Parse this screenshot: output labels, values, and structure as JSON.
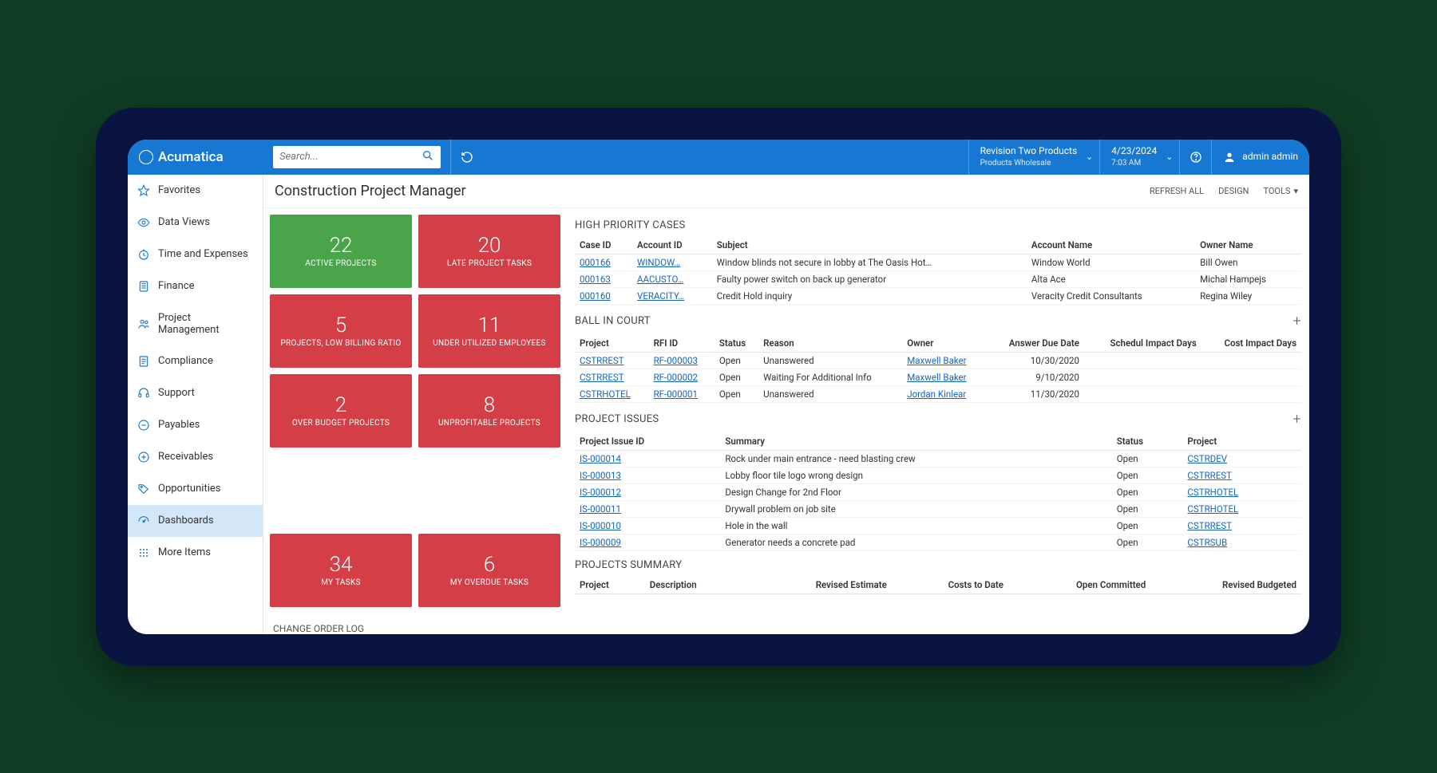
{
  "brand": "Acumatica",
  "search": {
    "placeholder": "Search..."
  },
  "tenant": {
    "name": "Revision Two Products",
    "sub": "Products Wholesale"
  },
  "datetime": {
    "date": "4/23/2024",
    "time": "7:03 AM"
  },
  "user": "admin admin",
  "sidebar": [
    {
      "icon": "star",
      "label": "Favorites"
    },
    {
      "icon": "eye",
      "label": "Data Views"
    },
    {
      "icon": "clock",
      "label": "Time and Expenses"
    },
    {
      "icon": "calc",
      "label": "Finance"
    },
    {
      "icon": "people",
      "label": "Project Management"
    },
    {
      "icon": "doc",
      "label": "Compliance"
    },
    {
      "icon": "headset",
      "label": "Support"
    },
    {
      "icon": "minus",
      "label": "Payables"
    },
    {
      "icon": "plus",
      "label": "Receivables"
    },
    {
      "icon": "tag",
      "label": "Opportunities"
    },
    {
      "icon": "gauge",
      "label": "Dashboards",
      "active": true
    },
    {
      "icon": "grid",
      "label": "More Items"
    }
  ],
  "page": {
    "title": "Construction Project Manager",
    "actions": {
      "refresh": "REFRESH ALL",
      "design": "DESIGN",
      "tools": "TOOLS"
    }
  },
  "tiles": [
    {
      "num": "22",
      "lbl": "ACTIVE PROJECTS",
      "color": "green"
    },
    {
      "num": "20",
      "lbl": "LATE PROJECT TASKS",
      "color": "red"
    },
    {
      "num": "5",
      "lbl": "PROJECTS, LOW BILLING RATIO",
      "color": "red"
    },
    {
      "num": "11",
      "lbl": "UNDER UTILIZED EMPLOYEES",
      "color": "red"
    },
    {
      "num": "2",
      "lbl": "OVER BUDGET PROJECTS",
      "color": "red"
    },
    {
      "num": "8",
      "lbl": "UNPROFITABLE PROJECTS",
      "color": "red"
    },
    {
      "num": "34",
      "lbl": "MY TASKS",
      "color": "red",
      "spaced": true
    },
    {
      "num": "6",
      "lbl": "MY OVERDUE TASKS",
      "color": "red"
    }
  ],
  "change_log_title": "CHANGE ORDER LOG",
  "high_priority": {
    "title": "HIGH PRIORITY CASES",
    "cols": [
      "Case ID",
      "Account ID",
      "Subject",
      "Account Name",
      "Owner Name"
    ],
    "rows": [
      {
        "case": "000166",
        "acct": "WINDOW…",
        "subj": "Window blinds not secure in lobby at The Oasis Hot…",
        "aname": "Window World",
        "owner": "Bill Owen"
      },
      {
        "case": "000163",
        "acct": "AACUSTO…",
        "subj": "Faulty power switch on back up generator",
        "aname": "Alta Ace",
        "owner": "Michal Hampejs"
      },
      {
        "case": "000160",
        "acct": "VERACITY…",
        "subj": "Credit Hold inquiry",
        "aname": "Veracity Credit Consultants",
        "owner": "Regina Wiley"
      }
    ]
  },
  "ball_in_court": {
    "title": "BALL IN COURT",
    "cols": [
      "Project",
      "RFI ID",
      "Status",
      "Reason",
      "Owner",
      "Answer Due Date",
      "Schedul Impact Days",
      "Cost Impact Days"
    ],
    "rows": [
      {
        "proj": "CSTRREST",
        "rfi": "RF-000003",
        "status": "Open",
        "reason": "Unanswered",
        "owner": "Maxwell Baker",
        "due": "10/30/2020"
      },
      {
        "proj": "CSTRREST",
        "rfi": "RF-000002",
        "status": "Open",
        "reason": "Waiting For Additional Info",
        "owner": "Maxwell Baker",
        "due": "9/10/2020"
      },
      {
        "proj": "CSTRHOTEL",
        "rfi": "RF-000001",
        "status": "Open",
        "reason": "Unanswered",
        "owner": "Jordan Kinlear",
        "due": "11/30/2020"
      }
    ]
  },
  "project_issues": {
    "title": "PROJECT ISSUES",
    "cols": [
      "Project Issue ID",
      "Summary",
      "Status",
      "Project"
    ],
    "rows": [
      {
        "id": "IS-000014",
        "sum": "Rock under main entrance - need blasting crew",
        "status": "Open",
        "proj": "CSTRDEV"
      },
      {
        "id": "IS-000013",
        "sum": "Lobby floor tile logo wrong design",
        "status": "Open",
        "proj": "CSTRREST"
      },
      {
        "id": "IS-000012",
        "sum": "Design Change for 2nd Floor",
        "status": "Open",
        "proj": "CSTRHOTEL"
      },
      {
        "id": "IS-000011",
        "sum": "Drywall problem on job site",
        "status": "Open",
        "proj": "CSTRHOTEL"
      },
      {
        "id": "IS-000010",
        "sum": "Hole in the wall",
        "status": "Open",
        "proj": "CSTRREST"
      },
      {
        "id": "IS-000009",
        "sum": "Generator needs a concrete pad",
        "status": "Open",
        "proj": "CSTRSUB"
      }
    ]
  },
  "projects_summary": {
    "title": "PROJECTS SUMMARY",
    "cols": [
      "Project",
      "Description",
      "Revised Estimate",
      "Costs to Date",
      "Open Committed",
      "Revised Budgeted"
    ]
  }
}
